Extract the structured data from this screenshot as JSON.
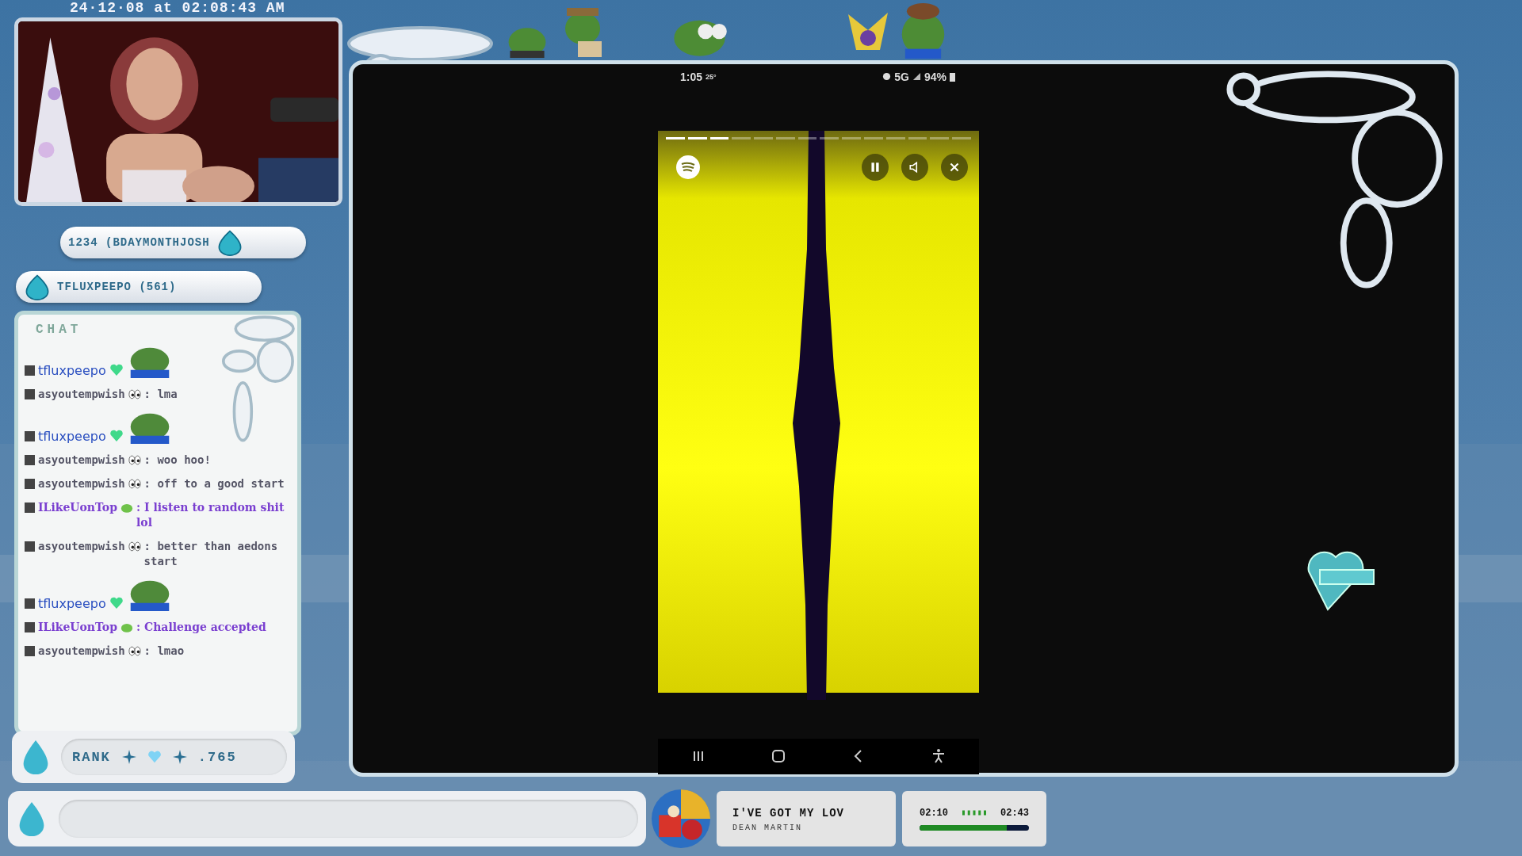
{
  "timestamp": "24·12·08 at 02:08:43 AM",
  "badges": [
    {
      "text": "1234 (BDAYMONTHJOSH"
    },
    {
      "text": "TFLUXPEEPO (561)"
    }
  ],
  "chat": {
    "title": "CHAT",
    "messages": [
      {
        "kind": "emote",
        "user": "tfluxpeepo"
      },
      {
        "kind": "mono",
        "user": "asyoutempwish",
        "text": ": lma"
      },
      {
        "kind": "emote",
        "user": "tfluxpeepo"
      },
      {
        "kind": "mono",
        "user": "asyoutempwish",
        "text": ": woo hoo!"
      },
      {
        "kind": "mono",
        "user": "asyoutempwish",
        "text": ": off to a good start"
      },
      {
        "kind": "bold",
        "user": "ILikeUonTop",
        "text": ": I listen to random shit lol"
      },
      {
        "kind": "mono",
        "user": "asyoutempwish",
        "text": ": better than aedons start"
      },
      {
        "kind": "emote",
        "user": "tfluxpeepo"
      },
      {
        "kind": "bold",
        "user": "ILikeUonTop",
        "text": ": Challenge accepted"
      },
      {
        "kind": "mono",
        "user": "asyoutempwish",
        "text": ": lmao"
      }
    ]
  },
  "rank": {
    "label": "RANK",
    "value": ".765"
  },
  "phone": {
    "time": "1:05",
    "temperature": "25°",
    "network": "5G",
    "battery": "94%",
    "story_segments": [
      {
        "filled": true
      },
      {
        "filled": true
      },
      {
        "filled": true
      },
      {
        "filled": false
      },
      {
        "filled": false
      },
      {
        "filled": false
      },
      {
        "filled": false
      },
      {
        "filled": false
      },
      {
        "filled": false
      },
      {
        "filled": false
      },
      {
        "filled": false
      },
      {
        "filled": false
      },
      {
        "filled": false
      },
      {
        "filled": false
      }
    ]
  },
  "now_playing": {
    "title": "I'VE GOT MY LOV",
    "artist": "DEAN MARTIN",
    "elapsed": "02:10",
    "total": "02:43",
    "level": 0.8
  }
}
